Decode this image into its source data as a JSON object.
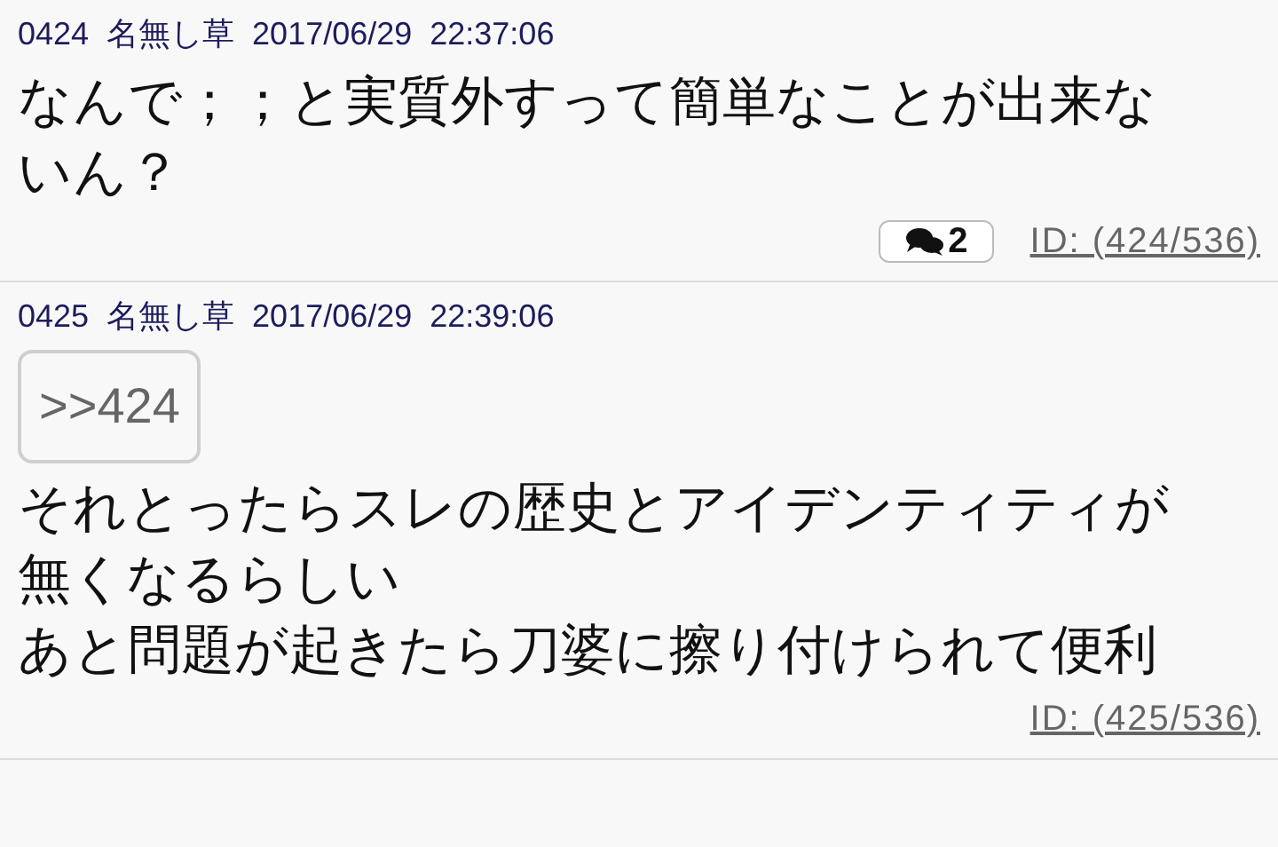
{
  "posts": [
    {
      "number": "0424",
      "name": "名無し草",
      "date": "2017/06/29",
      "time": "22:37:06",
      "body": [
        "なんで；；と実質外すって簡単なことが出来な",
        "いん？"
      ],
      "replies": "2",
      "id": "ID: (424/536)"
    },
    {
      "number": "0425",
      "name": "名無し草",
      "date": "2017/06/29",
      "time": "22:39:06",
      "anchor": ">>424",
      "body": [
        "それとったらスレの歴史とアイデンティティが",
        "無くなるらしい",
        "あと問題が起きたら刀婆に擦り付けられて便利"
      ],
      "id": "ID: (425/536)"
    }
  ]
}
